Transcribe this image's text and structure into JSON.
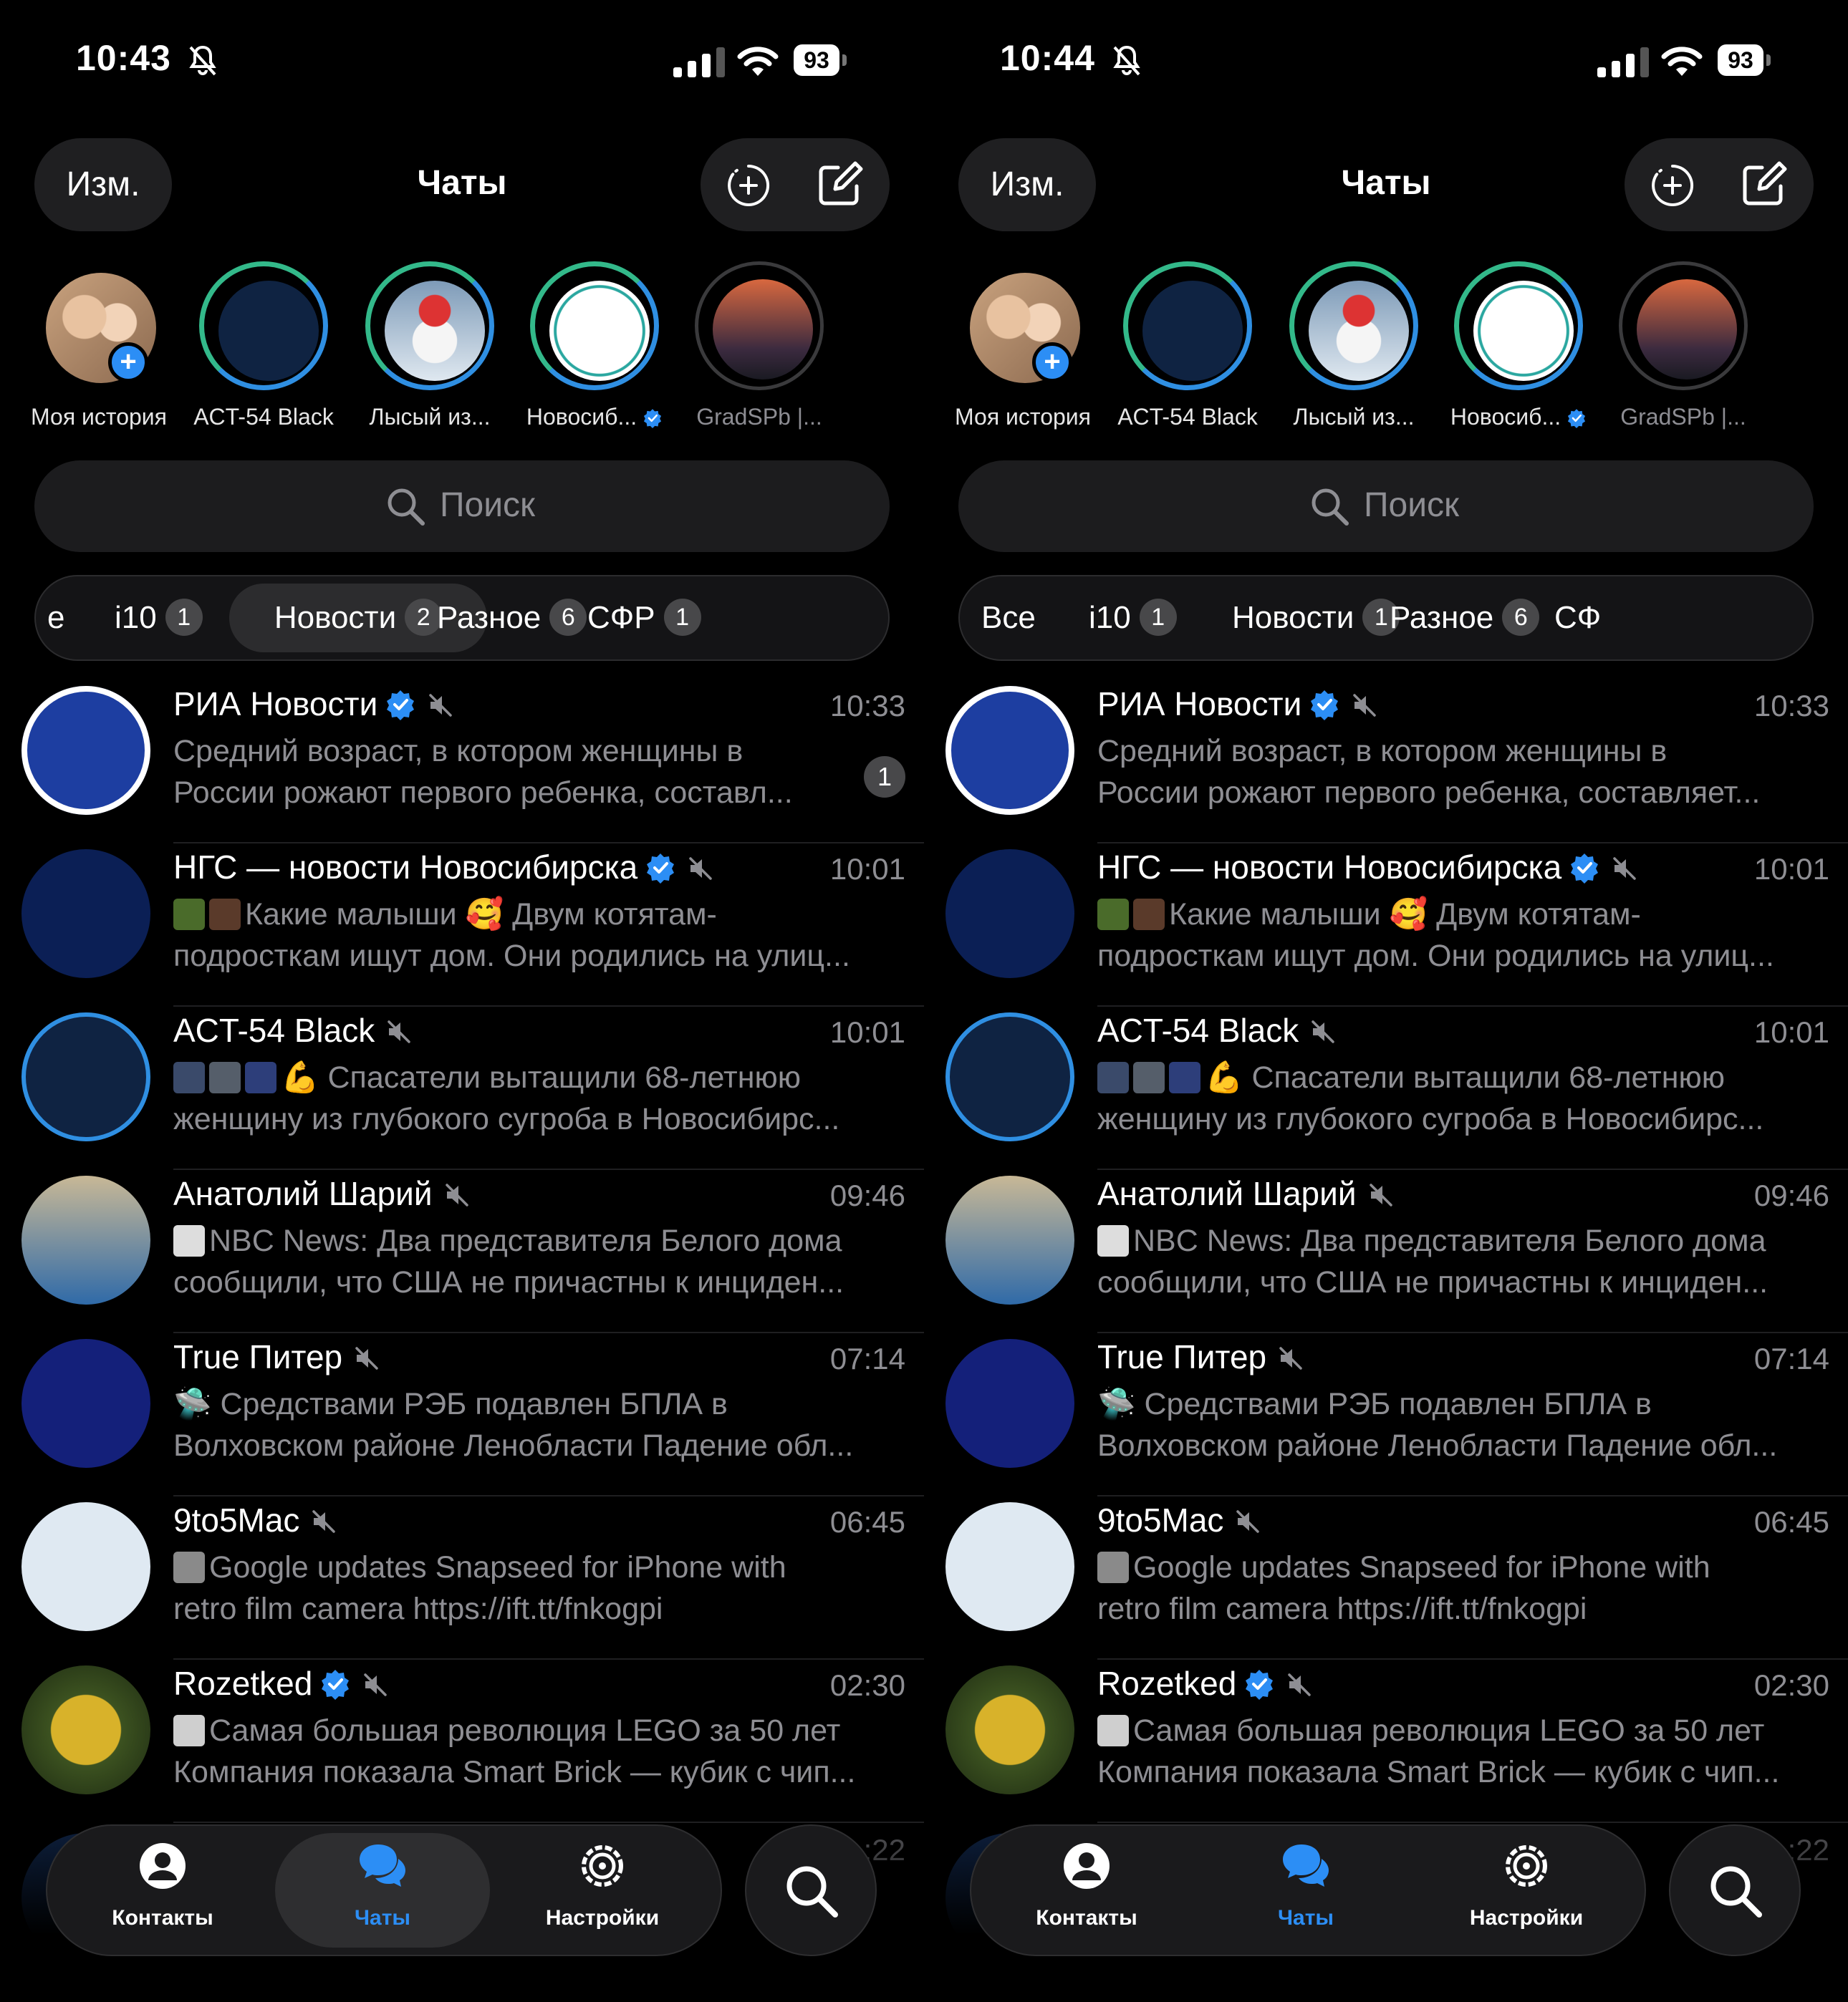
{
  "screens": [
    {
      "status": {
        "time": "10:43",
        "battery": "93"
      },
      "header": {
        "edit": "Изм.",
        "title": "Чаты"
      },
      "stories": [
        {
          "name": "Моя история"
        },
        {
          "name": "ACT-54 Black"
        },
        {
          "name": "Лысый из..."
        },
        {
          "name": "Новосиб..."
        },
        {
          "name": "GradSPb |..."
        }
      ],
      "search": {
        "placeholder": "Поиск"
      },
      "tabs": [
        {
          "label": "е",
          "badge": ""
        },
        {
          "label": "i10",
          "badge": "1"
        },
        {
          "label": "Новости",
          "badge": "2"
        },
        {
          "label": "Разное",
          "badge": "6"
        },
        {
          "label": "СФР",
          "badge": "1"
        }
      ],
      "chats": [
        {
          "title": "РИА Новости",
          "time": "10:33",
          "line1": "Средний возраст, в котором женщины в",
          "line2": "России рожают первого ребенка, составл...",
          "unread": "1"
        },
        {
          "title": "НГС — новости Новосибирска",
          "time": "10:01",
          "line1": "Какие малыши 🥰 Двум котятам-",
          "line2": "подросткам ищут дом. Они родились на улиц..."
        },
        {
          "title": "ACT-54 Black",
          "time": "10:01",
          "line1": "💪 Спасатели вытащили 68-летнюю",
          "line2": "женщину из глубокого сугроба в Новосибирс..."
        },
        {
          "title": "Анатолий Шарий",
          "time": "09:46",
          "line1": "NBC News: Два представителя Белого дома",
          "line2": "сообщили, что США не причастны к инциден..."
        },
        {
          "title": "True Питер",
          "time": "07:14",
          "line1": "🛸 Средствами РЭБ подавлен БПЛА в",
          "line2": "Волховском районе Ленобласти Падение обл..."
        },
        {
          "title": "9to5Mac",
          "time": "06:45",
          "line1": "Google updates Snapseed for iPhone with",
          "line2": "retro film camera https://ift.tt/fnkogpi"
        },
        {
          "title": "Rozetked",
          "time": "02:30",
          "line1": "Самая большая революция LEGO за 50 лет",
          "line2": "Компания показала Smart Brick — кубик с чип..."
        }
      ],
      "peek_time": ":22",
      "tabbar": {
        "contacts": "Контакты",
        "chats": "Чаты",
        "settings": "Настройки"
      }
    },
    {
      "status": {
        "time": "10:44",
        "battery": "93"
      },
      "header": {
        "edit": "Изм.",
        "title": "Чаты"
      },
      "stories": [
        {
          "name": "Моя история"
        },
        {
          "name": "ACT-54 Black"
        },
        {
          "name": "Лысый из..."
        },
        {
          "name": "Новосиб..."
        },
        {
          "name": "GradSPb |..."
        }
      ],
      "search": {
        "placeholder": "Поиск"
      },
      "tabs": [
        {
          "label": "Все",
          "badge": ""
        },
        {
          "label": "i10",
          "badge": "1"
        },
        {
          "label": "Новости",
          "badge": "1"
        },
        {
          "label": "Разное",
          "badge": "6"
        },
        {
          "label": "СФ",
          "badge": ""
        }
      ],
      "chats": [
        {
          "title": "РИА Новости",
          "time": "10:33",
          "line1": "Средний возраст, в котором женщины в",
          "line2": "России рожают первого ребенка, составляет...",
          "unread": ""
        },
        {
          "title": "НГС — новости Новосибирска",
          "time": "10:01",
          "line1": "Какие малыши 🥰 Двум котятам-",
          "line2": "подросткам ищут дом. Они родились на улиц..."
        },
        {
          "title": "ACT-54 Black",
          "time": "10:01",
          "line1": "💪 Спасатели вытащили 68-летнюю",
          "line2": "женщину из глубокого сугроба в Новосибирс..."
        },
        {
          "title": "Анатолий Шарий",
          "time": "09:46",
          "line1": "NBC News: Два представителя Белого дома",
          "line2": "сообщили, что США не причастны к инциден..."
        },
        {
          "title": "True Питер",
          "time": "07:14",
          "line1": "🛸 Средствами РЭБ подавлен БПЛА в",
          "line2": "Волховском районе Ленобласти Падение обл..."
        },
        {
          "title": "9to5Mac",
          "time": "06:45",
          "line1": "Google updates Snapseed for iPhone with",
          "line2": "retro film camera https://ift.tt/fnkogpi"
        },
        {
          "title": "Rozetked",
          "time": "02:30",
          "line1": "Самая большая революция LEGO за 50 лет",
          "line2": "Компания показала Smart Brick — кубик с чип..."
        }
      ],
      "peek_time": ":22",
      "tabbar": {
        "contacts": "Контакты",
        "chats": "Чаты",
        "settings": "Настройки"
      }
    }
  ],
  "colors": {
    "accent": "#2c8ef5",
    "verified": "#2c8ef5",
    "ring_green": "#33b98a",
    "ring_blue": "#2f8fe2"
  }
}
